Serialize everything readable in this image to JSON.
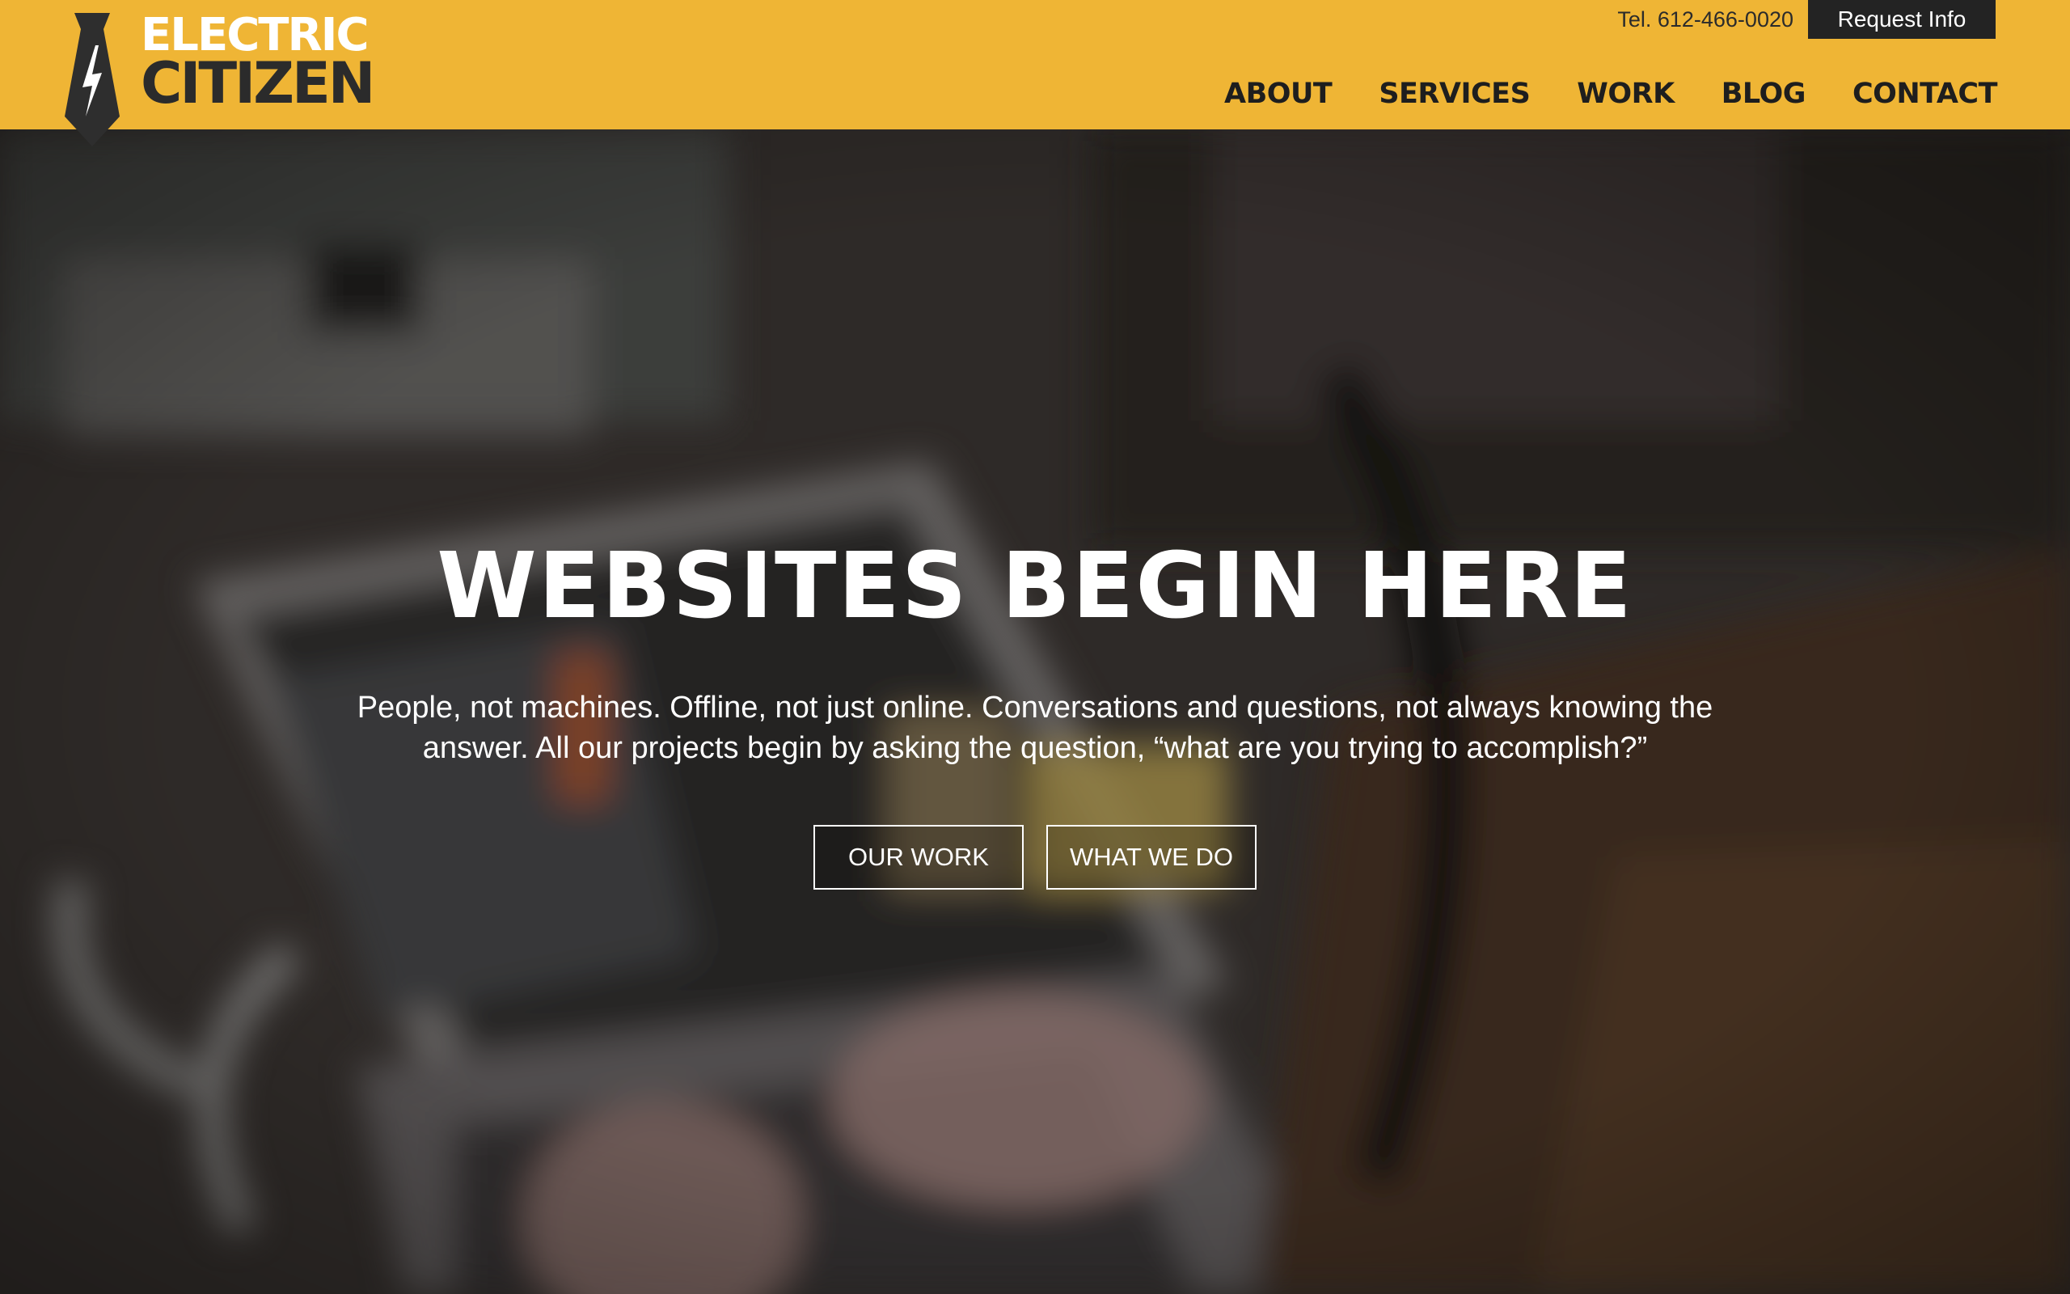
{
  "header": {
    "logo": {
      "line1": "ELECTRIC",
      "line2": "CITIZEN",
      "icon": "necktie-lightning-icon"
    },
    "phone": "Tel. 612-466-0020",
    "request_button": "Request Info",
    "nav": [
      {
        "label": "ABOUT"
      },
      {
        "label": "SERVICES"
      },
      {
        "label": "WORK"
      },
      {
        "label": "BLOG"
      },
      {
        "label": "CONTACT"
      }
    ]
  },
  "hero": {
    "title": "WEBSITES BEGIN HERE",
    "text": "People, not machines. Offline, not just online. Conversations and questions, not always knowing the answer. All our projects begin by asking the question, “what are you trying to accomplish?”",
    "buttons": [
      {
        "label": "OUR WORK"
      },
      {
        "label": "WHAT WE DO"
      }
    ],
    "background": "blurred-photo-laptop-typing"
  },
  "colors": {
    "brand_yellow": "#efb535",
    "dark": "#232323",
    "white": "#ffffff"
  }
}
